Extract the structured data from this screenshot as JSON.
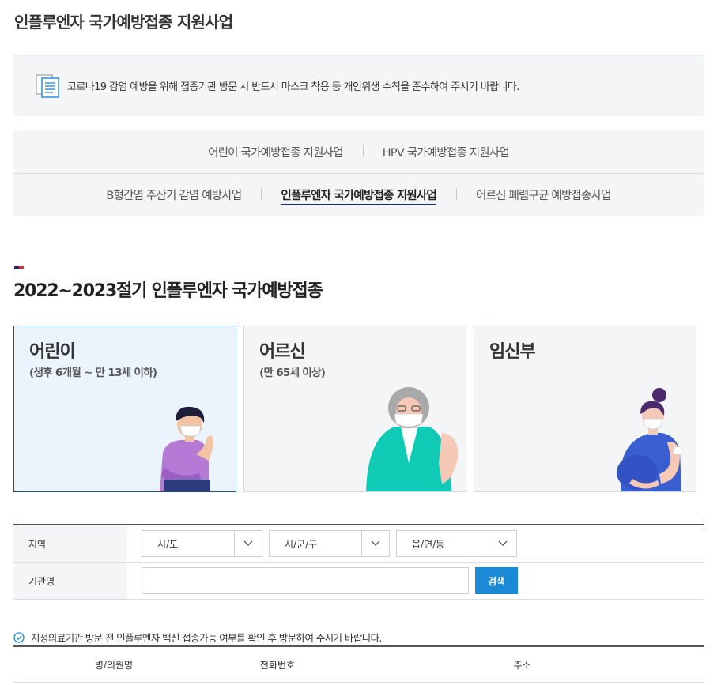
{
  "page": {
    "title": "인플루엔자 국가예방접종 지원사업"
  },
  "notice": {
    "icon": "document-icon",
    "text": "코로나19 감염 예방을 위해 접종기관 방문 시 반드시 마스크 착용 등 개인위생 수칙을 준수하여 주시기 바랍니다."
  },
  "tabs": {
    "row1": [
      "어린이 국가예방접종 지원사업",
      "HPV 국가예방접종 지원사업"
    ],
    "row2": [
      "B형간염 주산기 감염 예방사업",
      "인플루엔자 국가예방접종 지원사업",
      "어르신 폐렴구균 예방접종사업"
    ],
    "active": "인플루엔자 국가예방접종 지원사업"
  },
  "section": {
    "title": "2022~2023절기 인플루엔자 국가예방접종"
  },
  "cards": [
    {
      "title": "어린이",
      "sub": "(생후 6개월 ~ 만 13세 이하)",
      "illustration": "child-illustration"
    },
    {
      "title": "어르신",
      "sub": "(만 65세 이상)",
      "illustration": "senior-illustration"
    },
    {
      "title": "임신부",
      "sub": "",
      "illustration": "pregnant-illustration"
    }
  ],
  "search": {
    "region_label": "지역",
    "sido": "시/도",
    "sigungu": "시/군/구",
    "eupmyeondong": "읍/면/동",
    "name_label": "기관명",
    "name_value": "",
    "search_button": "검색"
  },
  "guide": {
    "icon": "check-circle-icon",
    "text": "지정의료기관 방문 전 인플루엔자 백신 접종가능 여부를 확인 후 방문하여 주시기 바랍니다."
  },
  "results": {
    "headers": [
      "병/의원명",
      "전화번호",
      "주소"
    ]
  },
  "colors": {
    "accent": "#1a8ad6",
    "navy": "#1e2f5e",
    "red": "#e0283c",
    "active_card_bg": "#ebf4fd"
  }
}
